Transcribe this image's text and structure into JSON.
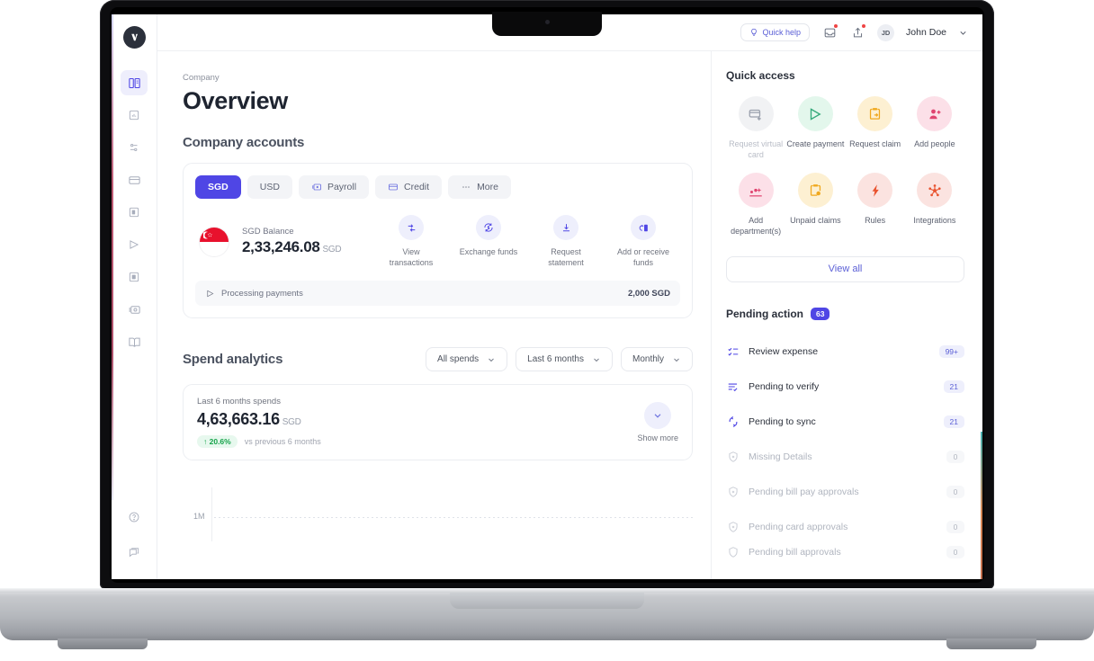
{
  "topbar": {
    "quick_help": "Quick help",
    "user_initials": "JD",
    "user_name": "John Doe"
  },
  "sidebar": {
    "items": [
      {
        "name": "overview",
        "icon": "building-icon",
        "active": true
      },
      {
        "name": "analytics",
        "icon": "chart-square-icon",
        "active": false
      },
      {
        "name": "approvals",
        "icon": "sliders-icon",
        "active": false
      },
      {
        "name": "cards",
        "icon": "credit-card-icon",
        "active": false
      },
      {
        "name": "expenses",
        "icon": "receipt-icon",
        "active": false
      },
      {
        "name": "payments",
        "icon": "send-icon",
        "active": false
      },
      {
        "name": "bills",
        "icon": "invoice-icon",
        "active": false
      },
      {
        "name": "payroll",
        "icon": "payroll-icon",
        "active": false
      },
      {
        "name": "accounting",
        "icon": "book-icon",
        "active": false
      }
    ],
    "bottom_items": [
      {
        "name": "help",
        "icon": "help-circle-icon"
      },
      {
        "name": "feedback",
        "icon": "chat-icon"
      }
    ]
  },
  "main": {
    "breadcrumb": "Company",
    "page_title": "Overview",
    "accounts_title": "Company accounts",
    "account_tabs": [
      {
        "label": "SGD",
        "icon": null,
        "active": true
      },
      {
        "label": "USD",
        "icon": null,
        "active": false
      },
      {
        "label": "Payroll",
        "icon": "payroll-icon",
        "active": false
      },
      {
        "label": "Credit",
        "icon": "credit-card-icon",
        "active": false
      },
      {
        "label": "More",
        "icon": "ellipsis-icon",
        "active": false
      }
    ],
    "balance": {
      "flag": "singapore-flag",
      "label": "SGD Balance",
      "amount": "2,33,246.08",
      "currency": "SGD"
    },
    "balance_actions": [
      {
        "label": "View transactions",
        "icon": "transactions-icon"
      },
      {
        "label": "Exchange funds",
        "icon": "exchange-icon"
      },
      {
        "label": "Request statement",
        "icon": "download-icon"
      },
      {
        "label": "Add or receive funds",
        "icon": "add-funds-icon"
      }
    ],
    "processing": {
      "icon": "send-icon",
      "label": "Processing payments",
      "value": "2,000 SGD"
    },
    "spend": {
      "title": "Spend analytics",
      "filters": [
        {
          "label": "All spends",
          "name": "spend-type"
        },
        {
          "label": "Last 6 months",
          "name": "date-range"
        },
        {
          "label": "Monthly",
          "name": "granularity"
        }
      ],
      "summary_label": "Last 6 months spends",
      "summary_amount": "4,63,663.16",
      "summary_currency": "SGD",
      "delta_pill": "↑ 20.6%",
      "delta_text": "vs previous 6 months",
      "show_more": "Show more"
    }
  },
  "chart_data": {
    "type": "line",
    "title": "Spend analytics",
    "xlabel": "",
    "ylabel": "",
    "categories": [],
    "values": [],
    "tick_labels": [
      "1M"
    ],
    "grid": true,
    "legend": "none",
    "note": "Chart area is cut off at the bottom of the viewport; only the 1M gridline is visible."
  },
  "right": {
    "quick_access_title": "Quick access",
    "quick_access": [
      {
        "label": "Request virtual card",
        "icon": "card-add-icon",
        "bg": "#f1f2f4",
        "fg": "#9aa0ac",
        "dim": true
      },
      {
        "label": "Create payment",
        "icon": "send-icon",
        "bg": "#e3f7ec",
        "fg": "#34a97a",
        "dim": false
      },
      {
        "label": "Request claim",
        "icon": "clipboard-arrow-icon",
        "bg": "#fdf0d2",
        "fg": "#f0a81e",
        "dim": false
      },
      {
        "label": "Add people",
        "icon": "user-add-icon",
        "bg": "#fce0e8",
        "fg": "#e0436f",
        "dim": false
      },
      {
        "label": "Add department(s)",
        "icon": "department-icon",
        "bg": "#fce0e8",
        "fg": "#e0436f",
        "dim": false
      },
      {
        "label": "Unpaid claims",
        "icon": "clipboard-clock-icon",
        "bg": "#fdf0d2",
        "fg": "#f0a81e",
        "dim": false
      },
      {
        "label": "Rules",
        "icon": "bolt-icon",
        "bg": "#fbe3e0",
        "fg": "#e9522e",
        "dim": false
      },
      {
        "label": "Integrations",
        "icon": "integrations-icon",
        "bg": "#fbe3e0",
        "fg": "#e9522e",
        "dim": false
      }
    ],
    "view_all": "View all",
    "pending_title": "Pending action",
    "pending_count": "63",
    "pending_rows": [
      {
        "label": "Review expense",
        "badge": "99+",
        "icon": "checklist-icon",
        "dim": false
      },
      {
        "label": "Pending to verify",
        "badge": "21",
        "icon": "list-check-icon",
        "dim": false
      },
      {
        "label": "Pending to sync",
        "badge": "21",
        "icon": "sync-icon",
        "dim": false
      },
      {
        "label": "Missing Details",
        "badge": "0",
        "icon": "shield-icon",
        "dim": true
      },
      {
        "label": "Pending bill pay approvals",
        "badge": "0",
        "icon": "shield-icon",
        "dim": true
      },
      {
        "label": "Pending card approvals",
        "badge": "0",
        "icon": "shield-icon",
        "dim": true
      },
      {
        "label": "Pending bill approvals",
        "badge": "0",
        "icon": "shield-icon",
        "dim": true
      }
    ]
  },
  "colors": {
    "accent": "#4f46e5",
    "accent_soft": "#eeeffc",
    "text_dark": "#1e2430",
    "text_muted": "#70747f",
    "success": "#16a34a",
    "danger": "#ef4444"
  }
}
